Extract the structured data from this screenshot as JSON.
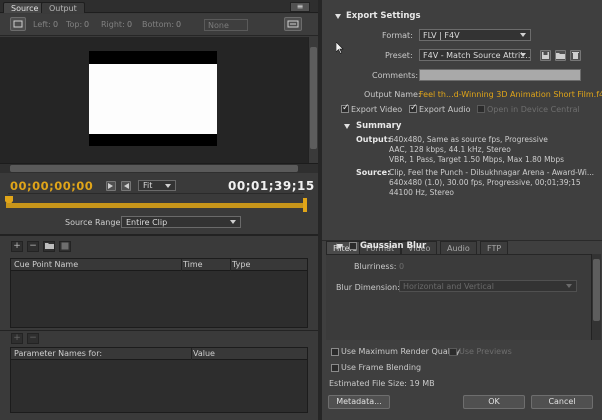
{
  "tabs": {
    "source": "Source",
    "output": "Output"
  },
  "crop": {
    "left_label": "Left:",
    "left_value": "0",
    "top_label": "Top:",
    "top_value": "0",
    "right_label": "Right:",
    "right_value": "0",
    "bottom_label": "Bottom:",
    "bottom_value": "0",
    "ratio": "None"
  },
  "monitor": {
    "timecode_current": "00;00;00;00",
    "timecode_duration": "00;01;39;15",
    "zoom": "Fit"
  },
  "source_range": {
    "label": "Source Range:",
    "value": "Entire Clip"
  },
  "cue_table": {
    "headers": [
      "Cue Point Name",
      "Time",
      "Type"
    ]
  },
  "param_table": {
    "headers": [
      "Parameter Names for:",
      "Value"
    ]
  },
  "export": {
    "title": "Export Settings",
    "format_label": "Format:",
    "format_value": "FLV | F4V",
    "preset_label": "Preset:",
    "preset_value": "F4V - Match Source Attrib...",
    "comments_label": "Comments:",
    "output_name_label": "Output Name:",
    "output_name_value": "Feel th...d-Winning 3D Animation Short Film.f4v",
    "export_video": "Export Video",
    "export_audio": "Export Audio",
    "open_device_central": "Open in Device Central"
  },
  "summary": {
    "title": "Summary",
    "output_label": "Output:",
    "output_lines": [
      "640x480, Same as source fps, Progressive",
      "AAC, 128 kbps, 44.1 kHz, Stereo",
      "VBR, 1 Pass, Target 1.50 Mbps, Max 1.80 Mbps"
    ],
    "source_label": "Source:",
    "source_lines": [
      "Clip, Feel the Punch - Dilsukhnagar Arena - Award-Wi...",
      "640x480 (1.0), 30.00 fps, Progressive, 00;01;39;15",
      "44100 Hz, Stereo"
    ]
  },
  "filter_tabs": [
    "Filters",
    "Format",
    "Video",
    "Audio",
    "FTP"
  ],
  "gaussian": {
    "title": "Gaussian Blur",
    "blurriness_label": "Blurriness:",
    "blurriness_value": "0",
    "dimension_label": "Blur Dimension:",
    "dimension_value": "Horizontal and Vertical"
  },
  "bottom": {
    "max_render": "Use Maximum Render Quality",
    "use_previews": "Use Previews",
    "frame_blending": "Use Frame Blending",
    "file_size": "Estimated File Size: 19 MB",
    "metadata": "Metadata...",
    "ok": "OK",
    "cancel": "Cancel"
  },
  "colors": {
    "accent": "#e0a519",
    "panel": "#3f3f3f",
    "dark": "#252525"
  }
}
